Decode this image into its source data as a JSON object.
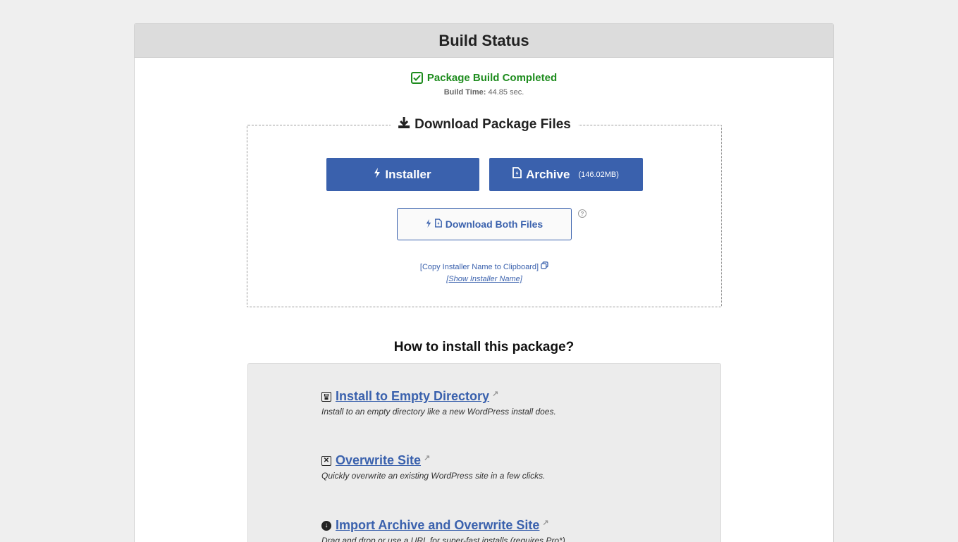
{
  "header": {
    "title": "Build Status"
  },
  "status": {
    "message": "Package Build Completed",
    "time_label": "Build Time:",
    "time_value": "44.85 sec."
  },
  "download": {
    "legend": "Download Package Files",
    "installer_label": "Installer",
    "archive_label": "Archive",
    "archive_size": "(146.02MB)",
    "both_label": "Download Both Files",
    "copy_label": "[Copy Installer Name to Clipboard]",
    "show_label": "[Show Installer Name]"
  },
  "install": {
    "title": "How to install this package?",
    "methods": [
      {
        "title": "Install to Empty Directory",
        "desc": "Install to an empty directory like a new WordPress install does."
      },
      {
        "title": "Overwrite Site",
        "desc": "Quickly overwrite an existing WordPress site in a few clicks."
      },
      {
        "title": "Import Archive and Overwrite Site",
        "desc": "Drag and drop or use a URL for super-fast installs (requires Pro*)"
      }
    ]
  },
  "colors": {
    "success": "#1e8c1e",
    "primary": "#3a61ad",
    "header_bg": "#dcdcdc"
  }
}
